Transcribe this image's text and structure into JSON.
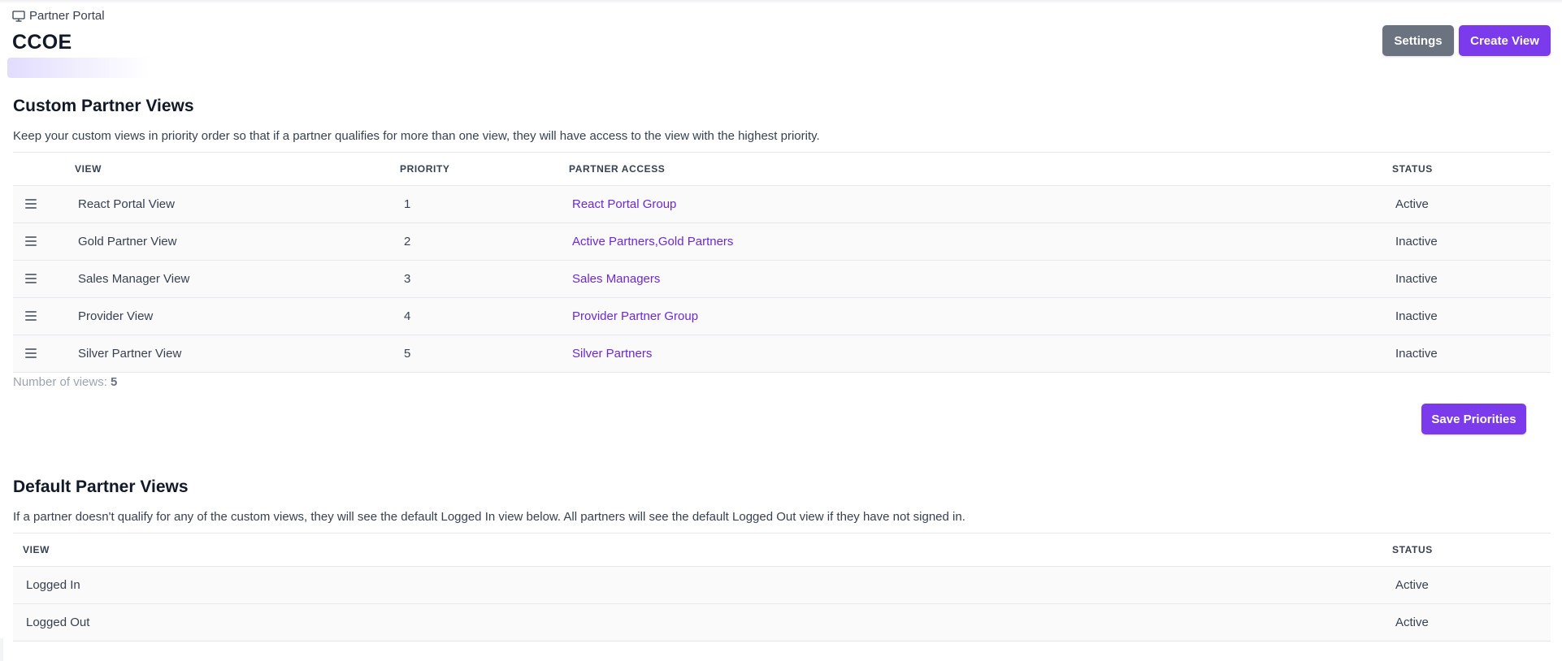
{
  "breadcrumb": {
    "label": "Partner Portal",
    "icon": "monitor-icon"
  },
  "page": {
    "title": "CCOE"
  },
  "header_actions": {
    "settings_label": "Settings",
    "create_label": "Create View"
  },
  "colors": {
    "accent": "#7c3aed",
    "link": "#6d28d9",
    "secondary_button": "#6b7280"
  },
  "custom_views": {
    "title": "Custom Partner Views",
    "description": "Keep your custom views in priority order so that if a partner qualifies for more than one view, they will have access to the view with the highest priority.",
    "columns": {
      "view": "VIEW",
      "priority": "PRIORITY",
      "access": "PARTNER ACCESS",
      "status": "STATUS"
    },
    "rows": [
      {
        "view": "React Portal View",
        "priority": "1",
        "access": "React Portal Group",
        "status": "Active"
      },
      {
        "view": "Gold Partner View",
        "priority": "2",
        "access": "Active Partners,Gold Partners",
        "status": "Inactive"
      },
      {
        "view": "Sales Manager View",
        "priority": "3",
        "access": "Sales Managers",
        "status": "Inactive"
      },
      {
        "view": "Provider View",
        "priority": "4",
        "access": "Provider Partner Group",
        "status": "Inactive"
      },
      {
        "view": "Silver Partner View",
        "priority": "5",
        "access": "Silver Partners",
        "status": "Inactive"
      }
    ],
    "count_label": "Number of views:",
    "count_value": "5",
    "save_label": "Save Priorities"
  },
  "default_views": {
    "title": "Default Partner Views",
    "description": "If a partner doesn't qualify for any of the custom views, they will see the default Logged In view below. All partners will see the default Logged Out view if they have not signed in.",
    "columns": {
      "view": "VIEW",
      "status": "STATUS"
    },
    "rows": [
      {
        "view": "Logged In",
        "status": "Active"
      },
      {
        "view": "Logged Out",
        "status": "Active"
      }
    ]
  }
}
